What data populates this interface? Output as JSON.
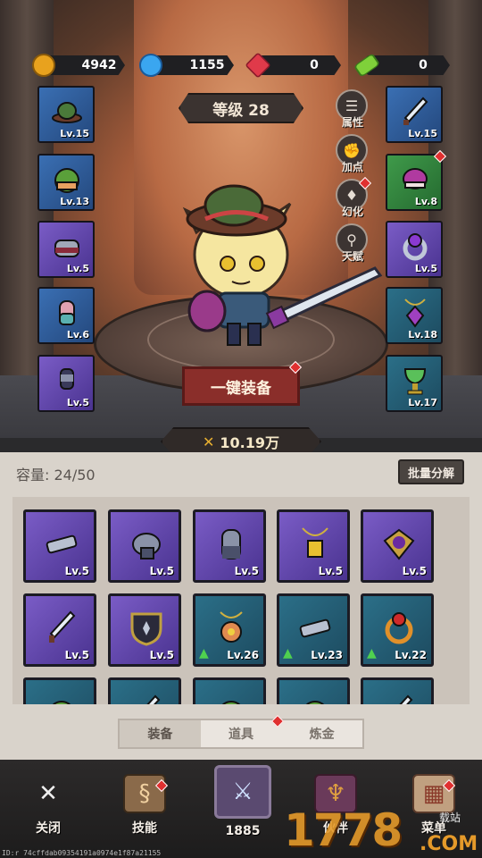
{
  "resources": [
    {
      "name": "gold",
      "value": "4942",
      "icon": "coin-icon",
      "color": "#e8a21e"
    },
    {
      "name": "diamond",
      "value": "1155",
      "icon": "blue-gem-icon",
      "color": "#3aa6f0"
    },
    {
      "name": "ruby",
      "value": "0",
      "icon": "red-gem-icon",
      "color": "#e03a4a"
    },
    {
      "name": "stamina",
      "value": "0",
      "icon": "green-battery-icon",
      "color": "#7fd13a"
    }
  ],
  "level_label": "等级 28",
  "side_buttons": [
    "属性",
    "加点",
    "幻化",
    "天赋"
  ],
  "left_slots": [
    {
      "level": "Lv.15",
      "rarity": "blue",
      "icon": "hat-icon"
    },
    {
      "level": "Lv.13",
      "rarity": "blue",
      "icon": "cap-icon"
    },
    {
      "level": "Lv.5",
      "rarity": "purple",
      "icon": "helmet-icon"
    },
    {
      "level": "Lv.6",
      "rarity": "blue",
      "icon": "gloves-icon"
    },
    {
      "level": "Lv.5",
      "rarity": "purple",
      "icon": "boots-icon"
    }
  ],
  "right_slots": [
    {
      "level": "Lv.15",
      "rarity": "blue",
      "icon": "sword-icon"
    },
    {
      "level": "Lv.8",
      "rarity": "green",
      "icon": "purple-hat-icon"
    },
    {
      "level": "Lv.5",
      "rarity": "purple",
      "icon": "ring-icon"
    },
    {
      "level": "Lv.18",
      "rarity": "teal",
      "icon": "amulet-icon"
    },
    {
      "level": "Lv.17",
      "rarity": "teal",
      "icon": "chalice-icon"
    }
  ],
  "equip_button": "一键装备",
  "power": "10.19万",
  "capacity": "容量: 24/50",
  "bulk_button": "批量分解",
  "inventory": [
    {
      "level": "Lv.5",
      "rarity": "purple",
      "icon": "bracer-icon",
      "upgrade": false
    },
    {
      "level": "Lv.5",
      "rarity": "purple",
      "icon": "gauntlet-icon",
      "upgrade": false
    },
    {
      "level": "Lv.5",
      "rarity": "purple",
      "icon": "glove-icon",
      "upgrade": false
    },
    {
      "level": "Lv.5",
      "rarity": "purple",
      "icon": "necklace-icon",
      "upgrade": false
    },
    {
      "level": "Lv.5",
      "rarity": "purple",
      "icon": "pendant-icon",
      "upgrade": false
    },
    {
      "level": "Lv.5",
      "rarity": "purple",
      "icon": "dagger-icon",
      "upgrade": false
    },
    {
      "level": "Lv.5",
      "rarity": "purple",
      "icon": "shield-icon",
      "upgrade": false
    },
    {
      "level": "Lv.26",
      "rarity": "teal",
      "icon": "flower-amulet-icon",
      "upgrade": true
    },
    {
      "level": "Lv.23",
      "rarity": "teal",
      "icon": "bracer-icon",
      "upgrade": true
    },
    {
      "level": "Lv.22",
      "rarity": "teal",
      "icon": "ruby-ring-icon",
      "upgrade": true
    },
    {
      "level": "",
      "rarity": "teal",
      "icon": "cap-icon",
      "upgrade": false
    },
    {
      "level": "",
      "rarity": "teal",
      "icon": "sword-icon",
      "upgrade": false
    },
    {
      "level": "",
      "rarity": "teal",
      "icon": "cap-icon",
      "upgrade": false
    },
    {
      "level": "",
      "rarity": "teal",
      "icon": "cap-icon",
      "upgrade": false
    },
    {
      "level": "",
      "rarity": "teal",
      "icon": "sword-icon",
      "upgrade": false
    }
  ],
  "tabs": [
    "装备",
    "道具",
    "炼金"
  ],
  "nav": [
    {
      "label": "关闭",
      "icon": "crossed-swords-icon"
    },
    {
      "label": "技能",
      "icon": "scroll-icon"
    },
    {
      "label": "1885",
      "icon": "battle-icon"
    },
    {
      "label": "伙伴",
      "icon": "wings-icon"
    },
    {
      "label": "菜单",
      "icon": "map-icon"
    }
  ],
  "watermark": {
    "main": "1778",
    "suffix": ".COM",
    "tag": "载站"
  },
  "user_id": "ID:r 74cffdab09354191a0974e1f87a21155"
}
